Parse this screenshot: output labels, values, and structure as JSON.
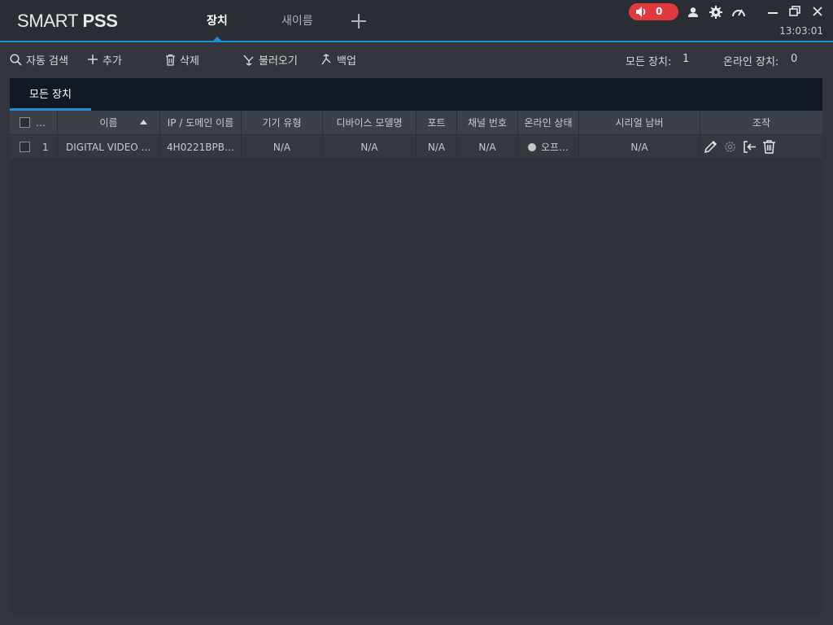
{
  "app": {
    "logo_light": "SMART ",
    "logo_bold": "PSS"
  },
  "tabs": [
    {
      "label": "장치"
    },
    {
      "label": "새이름"
    }
  ],
  "alarm": {
    "count": "0"
  },
  "clock": "13:03:01",
  "toolbar": {
    "auto_search": "자동 검색",
    "add": "추가",
    "delete": "삭제",
    "import": "불러오기",
    "backup": "백업",
    "all_devices_label": "모든 장치:",
    "all_devices_count": "1",
    "online_devices_label": "온라인 장치:",
    "online_devices_count": "0"
  },
  "panel": {
    "tab_all_devices": "모든 장치"
  },
  "table": {
    "headers": {
      "checkbox_more": "…",
      "name": "이름",
      "ip": "IP / 도메인 이름",
      "type": "기기 유형",
      "model": "디바이스 모델명",
      "port": "포트",
      "channel": "채널 번호",
      "status": "온라인 상태",
      "serial": "시리얼 남버",
      "ops": "조작"
    },
    "rows": [
      {
        "index": "1",
        "name": "DIGITAL VIDEO …",
        "ip": "4H0221BPB…",
        "type": "N/A",
        "model": "N/A",
        "port": "N/A",
        "channel": "N/A",
        "status": "오프…",
        "serial": "N/A"
      }
    ]
  },
  "colors": {
    "accent": "#1d8fd6",
    "alarm": "#e0393e",
    "background": "#33363d"
  }
}
